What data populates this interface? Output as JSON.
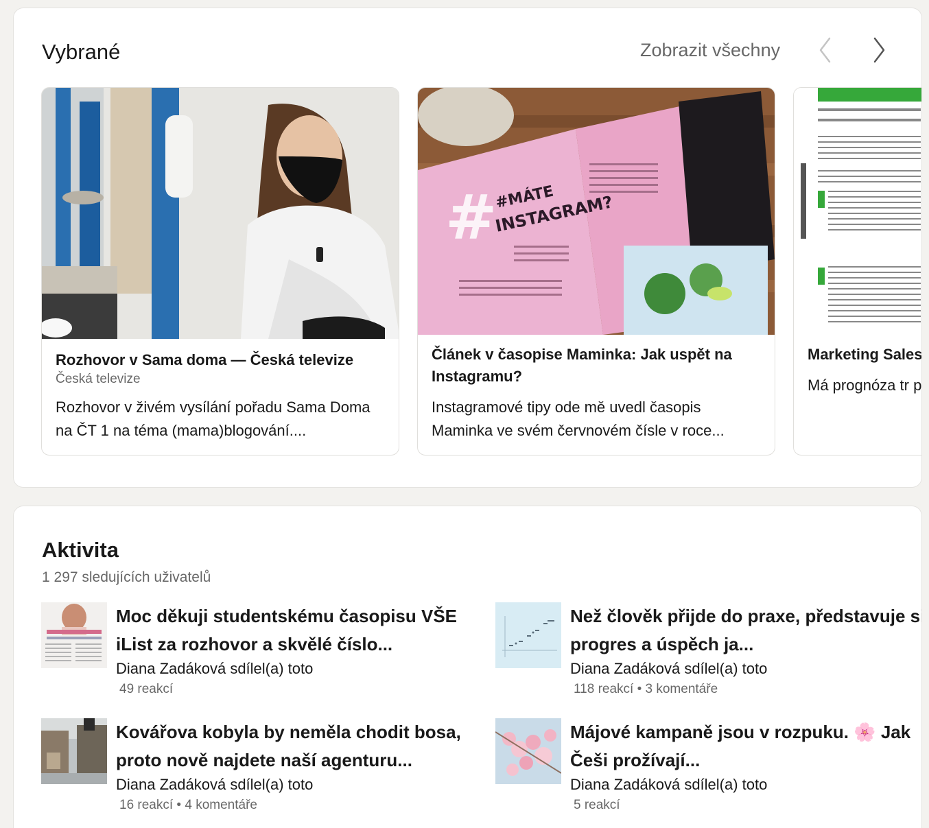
{
  "featured": {
    "title": "Vybrané",
    "show_all": "Zobrazit všechny",
    "cards": [
      {
        "title": "Rozhovor v Sama doma — Česká televize",
        "source": "Česká televize",
        "description": "Rozhovor v živém vysílání pořadu Sama Doma na ČT 1 na téma (mama)blogování...."
      },
      {
        "title": "Článek v časopise Maminka: Jak uspět na Instagramu?",
        "source": "",
        "description": "Instagramové tipy ode mě uvedl časopis Maminka ve svém červnovém čísle v roce..."
      },
      {
        "title": "Marketing Sales sociálních sítí",
        "source": "",
        "description": "Má prognóza tr pro týdenní Ma"
      }
    ]
  },
  "activity": {
    "title": "Aktivita",
    "followers": "1 297 sledujících uživatelů",
    "posts": [
      {
        "title": "Moc děkuji studentskému časopisu VŠE iList za rozhovor a skvělé číslo...",
        "shared": "Diana Zadáková sdílel(a) toto",
        "stats": "49 reakcí"
      },
      {
        "title": "Než člověk přijde do praxe, představuje si progres a úspěch ja...",
        "shared": "Diana Zadáková sdílel(a) toto",
        "stats": "118 reakcí • 3 komentáře"
      },
      {
        "title": "Kovářova kobyla by neměla chodit bosa, proto nově najdete naší agenturu...",
        "shared": "Diana Zadáková sdílel(a) toto",
        "stats": "16 reakcí • 4 komentáře"
      },
      {
        "title": "Májové kampaně jsou v rozpuku. 🌸 Jak Češi prožívají...",
        "shared": "Diana Zadáková sdílel(a) toto",
        "stats": "5 reakcí"
      }
    ]
  },
  "colors": {
    "page_bg": "#f3f2ef",
    "card_bg": "#ffffff",
    "secondary_text": "#666666",
    "magazine_pink": "#e9a5c7",
    "tv_blue": "#2a6fb0"
  },
  "icons": {
    "prev": "chevron-left-icon",
    "next": "chevron-right-icon"
  }
}
